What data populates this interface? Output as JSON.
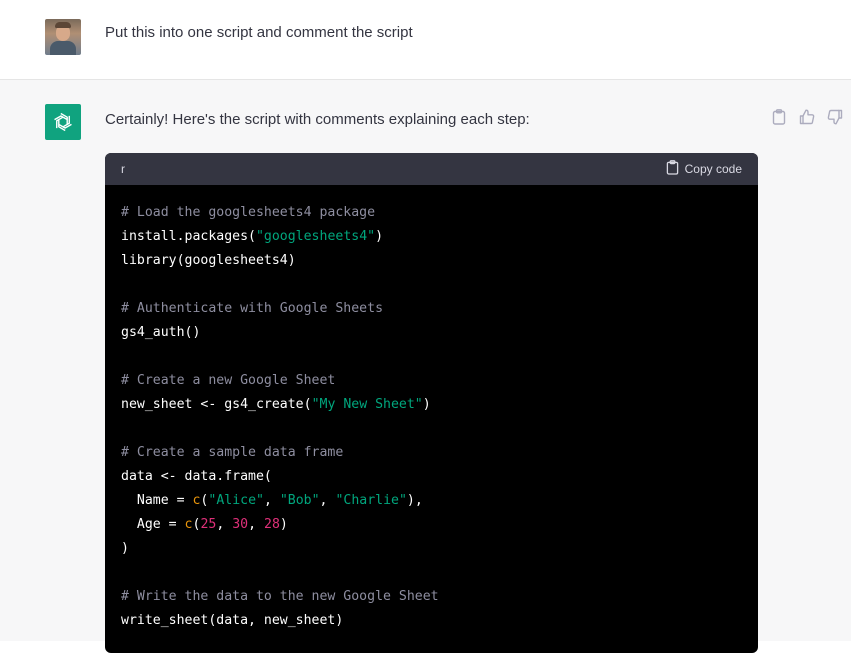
{
  "user_message": {
    "text": "Put this into one script and comment the script"
  },
  "assistant_message": {
    "intro": "Certainly! Here's the script with comments explaining each step:",
    "actions": [
      "clipboard-icon",
      "thumbs-up-icon",
      "thumbs-down-icon"
    ]
  },
  "code_block": {
    "language": "r",
    "copy_label": "Copy code",
    "lines": [
      [
        {
          "t": "comment",
          "v": "# Load the googlesheets4 package"
        }
      ],
      [
        {
          "t": "plain",
          "v": "install.packages("
        },
        {
          "t": "string",
          "v": "\"googlesheets4\""
        },
        {
          "t": "plain",
          "v": ")"
        }
      ],
      [
        {
          "t": "plain",
          "v": "library(googlesheets4)"
        }
      ],
      [],
      [
        {
          "t": "comment",
          "v": "# Authenticate with Google Sheets"
        }
      ],
      [
        {
          "t": "plain",
          "v": "gs4_auth()"
        }
      ],
      [],
      [
        {
          "t": "comment",
          "v": "# Create a new Google Sheet"
        }
      ],
      [
        {
          "t": "plain",
          "v": "new_sheet <- gs4_create("
        },
        {
          "t": "string",
          "v": "\"My New Sheet\""
        },
        {
          "t": "plain",
          "v": ")"
        }
      ],
      [],
      [
        {
          "t": "comment",
          "v": "# Create a sample data frame"
        }
      ],
      [
        {
          "t": "plain",
          "v": "data <- data.frame("
        }
      ],
      [
        {
          "t": "plain",
          "v": "  Name = "
        },
        {
          "t": "builtin",
          "v": "c"
        },
        {
          "t": "plain",
          "v": "("
        },
        {
          "t": "string",
          "v": "\"Alice\""
        },
        {
          "t": "plain",
          "v": ", "
        },
        {
          "t": "string",
          "v": "\"Bob\""
        },
        {
          "t": "plain",
          "v": ", "
        },
        {
          "t": "string",
          "v": "\"Charlie\""
        },
        {
          "t": "plain",
          "v": "),"
        }
      ],
      [
        {
          "t": "plain",
          "v": "  Age = "
        },
        {
          "t": "builtin",
          "v": "c"
        },
        {
          "t": "plain",
          "v": "("
        },
        {
          "t": "number",
          "v": "25"
        },
        {
          "t": "plain",
          "v": ", "
        },
        {
          "t": "number",
          "v": "30"
        },
        {
          "t": "plain",
          "v": ", "
        },
        {
          "t": "number",
          "v": "28"
        },
        {
          "t": "plain",
          "v": ")"
        }
      ],
      [
        {
          "t": "plain",
          "v": ")"
        }
      ],
      [],
      [
        {
          "t": "comment",
          "v": "# Write the data to the new Google Sheet"
        }
      ],
      [
        {
          "t": "plain",
          "v": "write_sheet(data, new_sheet)"
        }
      ]
    ]
  },
  "colors": {
    "brand_green": "#10a37f",
    "code_bg": "#000000",
    "code_header_bg": "#343541",
    "comment": "#8e8ea0",
    "string": "#00a67d",
    "builtin": "#e9950c",
    "number": "#df3079"
  }
}
